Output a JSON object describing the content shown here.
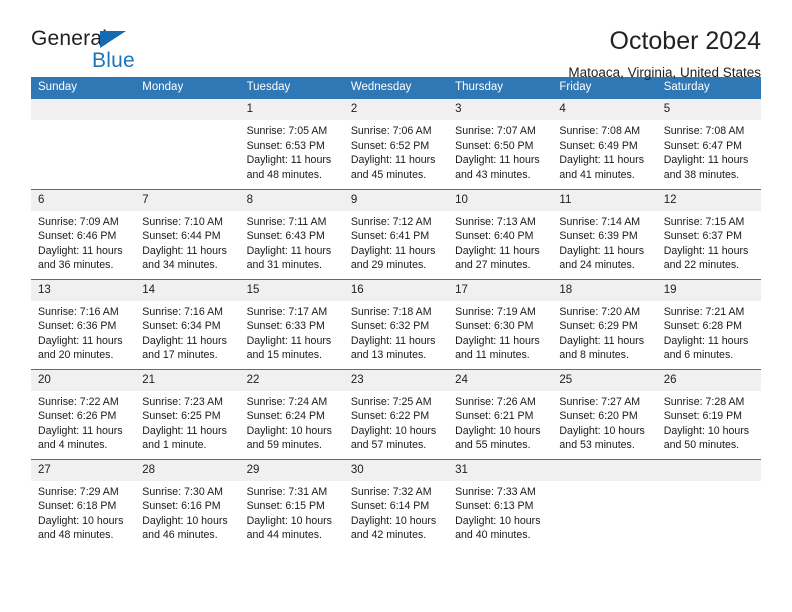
{
  "brand": {
    "name_top": "General",
    "name_bottom": "Blue",
    "accent_color": "#1b75bb"
  },
  "header": {
    "title": "October 2024",
    "subtitle": "Matoaca, Virginia, United States"
  },
  "calendar": {
    "header_color": "#2f77b5",
    "daynum_band_color": "#f0f0f0",
    "weekday_headers": [
      "Sunday",
      "Monday",
      "Tuesday",
      "Wednesday",
      "Thursday",
      "Friday",
      "Saturday"
    ],
    "weeks": [
      [
        {
          "day": "",
          "sunrise": "",
          "sunset": "",
          "daylight": ""
        },
        {
          "day": "",
          "sunrise": "",
          "sunset": "",
          "daylight": ""
        },
        {
          "day": "1",
          "sunrise": "Sunrise: 7:05 AM",
          "sunset": "Sunset: 6:53 PM",
          "daylight": "Daylight: 11 hours and 48 minutes."
        },
        {
          "day": "2",
          "sunrise": "Sunrise: 7:06 AM",
          "sunset": "Sunset: 6:52 PM",
          "daylight": "Daylight: 11 hours and 45 minutes."
        },
        {
          "day": "3",
          "sunrise": "Sunrise: 7:07 AM",
          "sunset": "Sunset: 6:50 PM",
          "daylight": "Daylight: 11 hours and 43 minutes."
        },
        {
          "day": "4",
          "sunrise": "Sunrise: 7:08 AM",
          "sunset": "Sunset: 6:49 PM",
          "daylight": "Daylight: 11 hours and 41 minutes."
        },
        {
          "day": "5",
          "sunrise": "Sunrise: 7:08 AM",
          "sunset": "Sunset: 6:47 PM",
          "daylight": "Daylight: 11 hours and 38 minutes."
        }
      ],
      [
        {
          "day": "6",
          "sunrise": "Sunrise: 7:09 AM",
          "sunset": "Sunset: 6:46 PM",
          "daylight": "Daylight: 11 hours and 36 minutes."
        },
        {
          "day": "7",
          "sunrise": "Sunrise: 7:10 AM",
          "sunset": "Sunset: 6:44 PM",
          "daylight": "Daylight: 11 hours and 34 minutes."
        },
        {
          "day": "8",
          "sunrise": "Sunrise: 7:11 AM",
          "sunset": "Sunset: 6:43 PM",
          "daylight": "Daylight: 11 hours and 31 minutes."
        },
        {
          "day": "9",
          "sunrise": "Sunrise: 7:12 AM",
          "sunset": "Sunset: 6:41 PM",
          "daylight": "Daylight: 11 hours and 29 minutes."
        },
        {
          "day": "10",
          "sunrise": "Sunrise: 7:13 AM",
          "sunset": "Sunset: 6:40 PM",
          "daylight": "Daylight: 11 hours and 27 minutes."
        },
        {
          "day": "11",
          "sunrise": "Sunrise: 7:14 AM",
          "sunset": "Sunset: 6:39 PM",
          "daylight": "Daylight: 11 hours and 24 minutes."
        },
        {
          "day": "12",
          "sunrise": "Sunrise: 7:15 AM",
          "sunset": "Sunset: 6:37 PM",
          "daylight": "Daylight: 11 hours and 22 minutes."
        }
      ],
      [
        {
          "day": "13",
          "sunrise": "Sunrise: 7:16 AM",
          "sunset": "Sunset: 6:36 PM",
          "daylight": "Daylight: 11 hours and 20 minutes."
        },
        {
          "day": "14",
          "sunrise": "Sunrise: 7:16 AM",
          "sunset": "Sunset: 6:34 PM",
          "daylight": "Daylight: 11 hours and 17 minutes."
        },
        {
          "day": "15",
          "sunrise": "Sunrise: 7:17 AM",
          "sunset": "Sunset: 6:33 PM",
          "daylight": "Daylight: 11 hours and 15 minutes."
        },
        {
          "day": "16",
          "sunrise": "Sunrise: 7:18 AM",
          "sunset": "Sunset: 6:32 PM",
          "daylight": "Daylight: 11 hours and 13 minutes."
        },
        {
          "day": "17",
          "sunrise": "Sunrise: 7:19 AM",
          "sunset": "Sunset: 6:30 PM",
          "daylight": "Daylight: 11 hours and 11 minutes."
        },
        {
          "day": "18",
          "sunrise": "Sunrise: 7:20 AM",
          "sunset": "Sunset: 6:29 PM",
          "daylight": "Daylight: 11 hours and 8 minutes."
        },
        {
          "day": "19",
          "sunrise": "Sunrise: 7:21 AM",
          "sunset": "Sunset: 6:28 PM",
          "daylight": "Daylight: 11 hours and 6 minutes."
        }
      ],
      [
        {
          "day": "20",
          "sunrise": "Sunrise: 7:22 AM",
          "sunset": "Sunset: 6:26 PM",
          "daylight": "Daylight: 11 hours and 4 minutes."
        },
        {
          "day": "21",
          "sunrise": "Sunrise: 7:23 AM",
          "sunset": "Sunset: 6:25 PM",
          "daylight": "Daylight: 11 hours and 1 minute."
        },
        {
          "day": "22",
          "sunrise": "Sunrise: 7:24 AM",
          "sunset": "Sunset: 6:24 PM",
          "daylight": "Daylight: 10 hours and 59 minutes."
        },
        {
          "day": "23",
          "sunrise": "Sunrise: 7:25 AM",
          "sunset": "Sunset: 6:22 PM",
          "daylight": "Daylight: 10 hours and 57 minutes."
        },
        {
          "day": "24",
          "sunrise": "Sunrise: 7:26 AM",
          "sunset": "Sunset: 6:21 PM",
          "daylight": "Daylight: 10 hours and 55 minutes."
        },
        {
          "day": "25",
          "sunrise": "Sunrise: 7:27 AM",
          "sunset": "Sunset: 6:20 PM",
          "daylight": "Daylight: 10 hours and 53 minutes."
        },
        {
          "day": "26",
          "sunrise": "Sunrise: 7:28 AM",
          "sunset": "Sunset: 6:19 PM",
          "daylight": "Daylight: 10 hours and 50 minutes."
        }
      ],
      [
        {
          "day": "27",
          "sunrise": "Sunrise: 7:29 AM",
          "sunset": "Sunset: 6:18 PM",
          "daylight": "Daylight: 10 hours and 48 minutes."
        },
        {
          "day": "28",
          "sunrise": "Sunrise: 7:30 AM",
          "sunset": "Sunset: 6:16 PM",
          "daylight": "Daylight: 10 hours and 46 minutes."
        },
        {
          "day": "29",
          "sunrise": "Sunrise: 7:31 AM",
          "sunset": "Sunset: 6:15 PM",
          "daylight": "Daylight: 10 hours and 44 minutes."
        },
        {
          "day": "30",
          "sunrise": "Sunrise: 7:32 AM",
          "sunset": "Sunset: 6:14 PM",
          "daylight": "Daylight: 10 hours and 42 minutes."
        },
        {
          "day": "31",
          "sunrise": "Sunrise: 7:33 AM",
          "sunset": "Sunset: 6:13 PM",
          "daylight": "Daylight: 10 hours and 40 minutes."
        },
        {
          "day": "",
          "sunrise": "",
          "sunset": "",
          "daylight": ""
        },
        {
          "day": "",
          "sunrise": "",
          "sunset": "",
          "daylight": ""
        }
      ]
    ]
  }
}
